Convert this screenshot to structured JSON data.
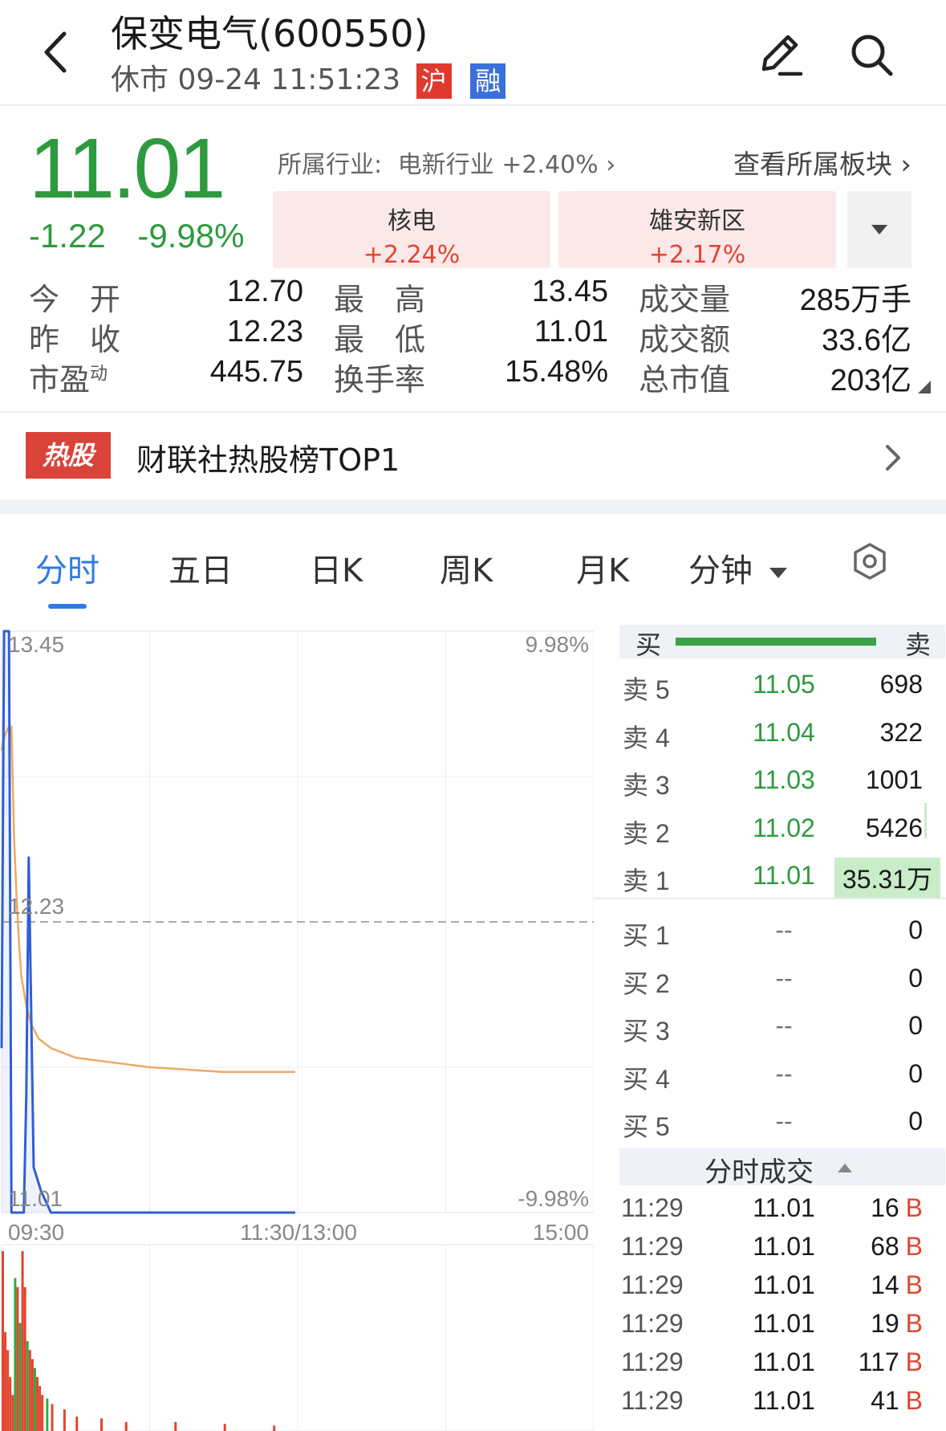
{
  "header": {
    "title": "保变电气(600550)",
    "status_line": "休市 09-24 11:51:23",
    "tags": [
      {
        "label": "沪",
        "color": "#e03a2f"
      },
      {
        "label": "融",
        "color": "#3b6fd9"
      }
    ],
    "icons": [
      "back-arrow-icon",
      "edit-pencil-icon",
      "search-icon"
    ]
  },
  "quote": {
    "price": "11.01",
    "change": "-1.22",
    "change_pct": "-9.98%",
    "industry_label": "所属行业:",
    "industry_name": "电新行业",
    "industry_change": "+2.40%",
    "view_sector": "查看所属板块",
    "sectors": [
      {
        "name": "核电",
        "change": "+2.24%"
      },
      {
        "name": "雄安新区",
        "change": "+2.17%"
      }
    ]
  },
  "stats": [
    [
      {
        "label": "今　开",
        "value": "12.70",
        "color": "red"
      },
      {
        "label": "最　高",
        "value": "13.45",
        "color": "red"
      },
      {
        "label": "成交量",
        "value": "285万手"
      }
    ],
    [
      {
        "label": "昨　收",
        "value": "12.23"
      },
      {
        "label": "最　低",
        "value": "11.01",
        "color": "green"
      },
      {
        "label": "成交额",
        "value": "33.6亿"
      }
    ],
    [
      {
        "label": "市盈",
        "label_sup": "动",
        "value": "445.75"
      },
      {
        "label": "换手率",
        "value": "15.48%"
      },
      {
        "label": "总市值",
        "value": "203亿"
      }
    ]
  ],
  "hot": {
    "badge": "热股",
    "text": "财联社热股榜TOP1"
  },
  "tabs": [
    "分时",
    "五日",
    "日K",
    "周K",
    "月K",
    "分钟"
  ],
  "active_tab": "分时",
  "chart_data": {
    "type": "line",
    "title": "",
    "xlabel": "",
    "ylabel": "",
    "x_ticks": [
      "09:30",
      "11:30/13:00",
      "15:00"
    ],
    "y_ticks_left": [
      "13.45",
      "12.23",
      "11.01"
    ],
    "y_ticks_right": [
      "9.98%",
      "-9.98%"
    ],
    "ylim": [
      11.01,
      13.45
    ],
    "prev_close": 12.23,
    "series": [
      {
        "name": "",
        "color": "#2f5fd6",
        "x": [
          "09:30",
          "09:31",
          "09:32",
          "09:33",
          "09:34",
          "09:35",
          "09:36",
          "09:37",
          "09:38",
          "09:39",
          "09:40",
          "09:41",
          "09:43",
          "09:46",
          "09:50",
          "09:55",
          "10:00",
          "10:30",
          "11:00",
          "11:29"
        ],
        "values": [
          11.7,
          13.45,
          13.45,
          13.45,
          11.01,
          11.01,
          11.01,
          11.01,
          11.01,
          11.01,
          11.5,
          12.5,
          11.2,
          11.1,
          11.01,
          11.01,
          11.01,
          11.01,
          11.01,
          11.01
        ]
      },
      {
        "name": "",
        "color": "#f1a766",
        "x": [
          "09:30",
          "09:31",
          "09:32",
          "09:33",
          "09:34",
          "09:35",
          "09:36",
          "09:37",
          "09:38",
          "09:40",
          "09:42",
          "09:45",
          "09:50",
          "10:00",
          "10:15",
          "10:30",
          "11:00",
          "11:29"
        ],
        "values": [
          12.95,
          13.0,
          13.03,
          13.05,
          13.05,
          12.6,
          12.35,
          12.15,
          12.0,
          11.88,
          11.8,
          11.74,
          11.7,
          11.66,
          11.64,
          11.62,
          11.6,
          11.6
        ]
      }
    ],
    "volume": {
      "type": "bar",
      "x": [
        "09:30",
        "09:31",
        "09:32",
        "09:33",
        "09:34",
        "09:35",
        "09:36",
        "09:37",
        "09:38",
        "09:39",
        "09:40",
        "09:41",
        "09:42",
        "09:43",
        "09:44",
        "09:45",
        "09:46",
        "09:48",
        "09:50",
        "09:55",
        "10:00",
        "10:10",
        "10:20",
        "10:40",
        "11:00",
        "11:20"
      ],
      "values": [
        1.0,
        0.55,
        0.45,
        0.3,
        0.2,
        0.85,
        0.8,
        0.6,
        1.0,
        0.8,
        0.5,
        0.45,
        0.4,
        0.35,
        0.3,
        0.25,
        0.2,
        0.18,
        0.15,
        0.12,
        0.08,
        0.07,
        0.05,
        0.05,
        0.04,
        0.03
      ],
      "colors": [
        "red",
        "red",
        "red",
        "red",
        "red",
        "green",
        "red",
        "green",
        "red",
        "red",
        "green",
        "red",
        "red",
        "green",
        "red",
        "red",
        "red",
        "green",
        "red",
        "red",
        "red",
        "red",
        "red",
        "red",
        "red",
        "red"
      ]
    }
  },
  "orderbook": {
    "header_buy": "买",
    "header_sell": "卖",
    "asks": [
      {
        "label": "卖 5",
        "price": "11.05",
        "vol": "698"
      },
      {
        "label": "卖 4",
        "price": "11.04",
        "vol": "322"
      },
      {
        "label": "卖 3",
        "price": "11.03",
        "vol": "1001"
      },
      {
        "label": "卖 2",
        "price": "11.02",
        "vol": "5426"
      },
      {
        "label": "卖 1",
        "price": "11.01",
        "vol": "35.31万"
      }
    ],
    "bids": [
      {
        "label": "买 1",
        "price": "--",
        "vol": "0"
      },
      {
        "label": "买 2",
        "price": "--",
        "vol": "0"
      },
      {
        "label": "买 3",
        "price": "--",
        "vol": "0"
      },
      {
        "label": "买 4",
        "price": "--",
        "vol": "0"
      },
      {
        "label": "买 5",
        "price": "--",
        "vol": "0"
      }
    ]
  },
  "trades": {
    "title": "分时成交",
    "rows": [
      {
        "time": "11:29",
        "price": "11.01",
        "vol": "16",
        "side": "B"
      },
      {
        "time": "11:29",
        "price": "11.01",
        "vol": "68",
        "side": "B"
      },
      {
        "time": "11:29",
        "price": "11.01",
        "vol": "14",
        "side": "B"
      },
      {
        "time": "11:29",
        "price": "11.01",
        "vol": "19",
        "side": "B"
      },
      {
        "time": "11:29",
        "price": "11.01",
        "vol": "117",
        "side": "B"
      },
      {
        "time": "11:29",
        "price": "11.01",
        "vol": "41",
        "side": "B"
      }
    ]
  }
}
